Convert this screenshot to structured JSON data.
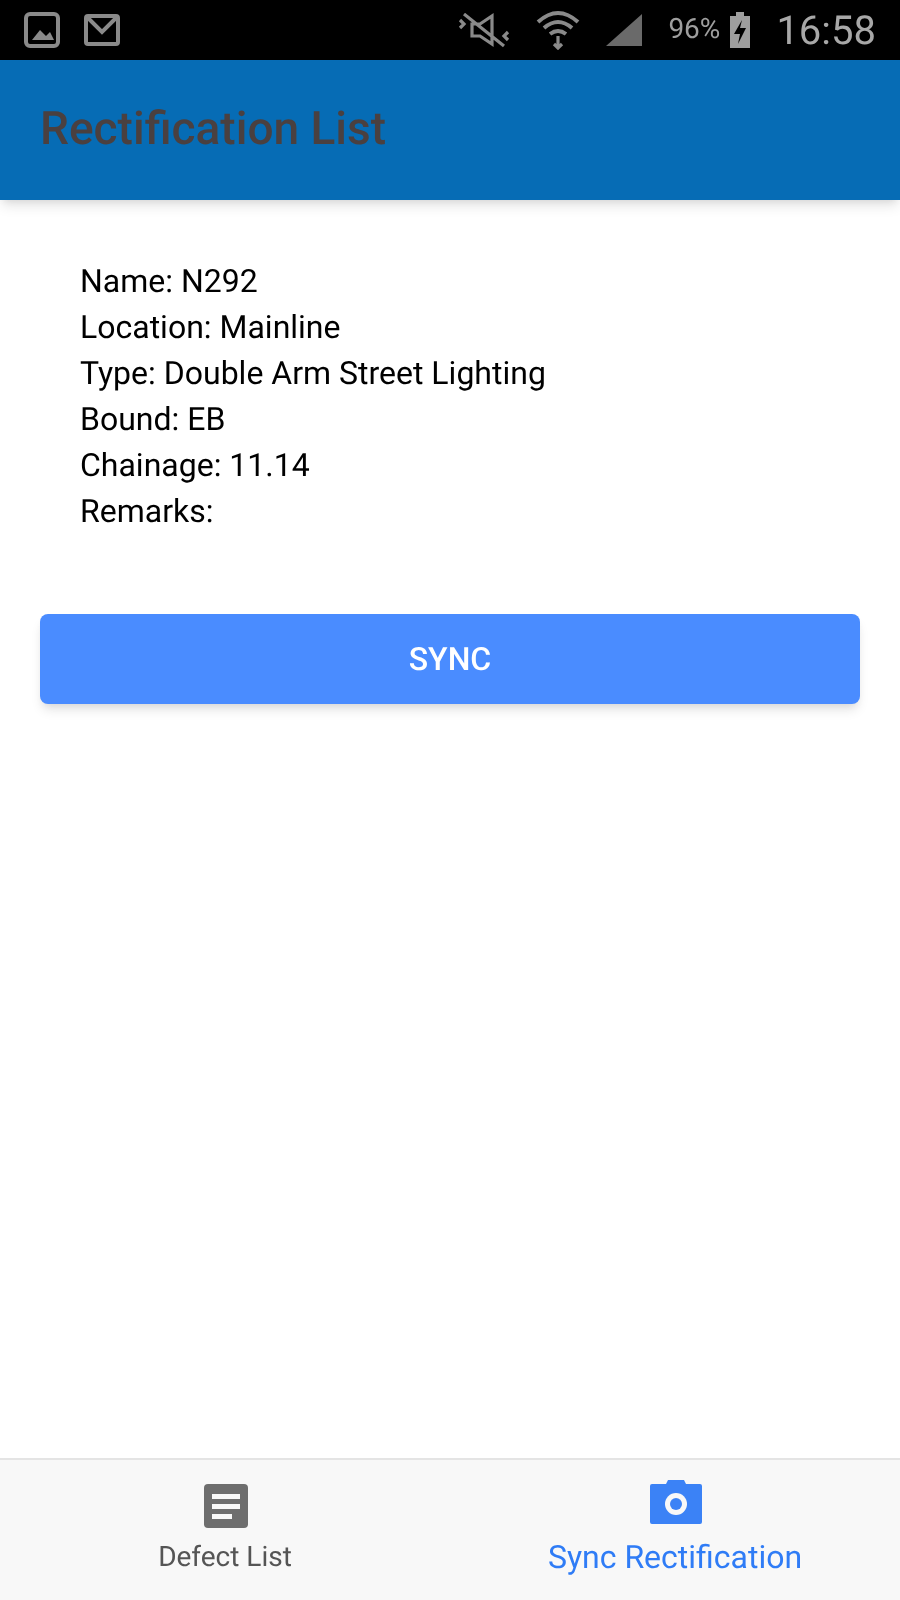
{
  "status_bar": {
    "battery": "96%",
    "time": "16:58"
  },
  "app_bar": {
    "title": "Rectification List"
  },
  "details": [
    "Name: N292",
    "Location: Mainline",
    "Type: Double Arm Street Lighting",
    "Bound: EB",
    "Chainage: 11.14",
    "Remarks:"
  ],
  "sync_button": {
    "label": "SYNC"
  },
  "bottom_tabs": [
    {
      "label": "Defect List",
      "kind": "list",
      "selected": false
    },
    {
      "label": "Sync Rectification",
      "kind": "camera",
      "selected": true
    }
  ]
}
